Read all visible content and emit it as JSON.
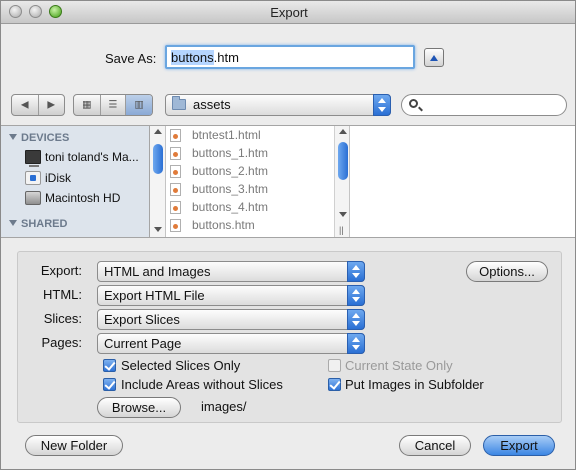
{
  "window": {
    "title": "Export"
  },
  "save_as": {
    "label": "Save As:",
    "value_selected": "buttons",
    "value_rest": ".htm"
  },
  "toolbar": {
    "nav_back": "◀",
    "nav_forward": "▶",
    "location": "assets",
    "search_placeholder": ""
  },
  "sidebar": {
    "devices_header": "DEVICES",
    "shared_header": "SHARED",
    "items": [
      {
        "label": "toni toland's Ma...",
        "icon": "computer-icon"
      },
      {
        "label": "iDisk",
        "icon": "idisk-icon"
      },
      {
        "label": "Macintosh HD",
        "icon": "hard-drive-icon"
      }
    ]
  },
  "files": [
    "btntest1.html",
    "buttons_1.htm",
    "buttons_2.htm",
    "buttons_3.htm",
    "buttons_4.htm",
    "buttons.htm"
  ],
  "options": {
    "export_label": "Export:",
    "export_value": "HTML and Images",
    "html_label": "HTML:",
    "html_value": "Export HTML File",
    "slices_label": "Slices:",
    "slices_value": "Export Slices",
    "pages_label": "Pages:",
    "pages_value": "Current Page",
    "options_button": "Options...",
    "selected_slices_only": "Selected Slices Only",
    "current_state_only": "Current State Only",
    "include_areas": "Include Areas without Slices",
    "put_images_subfolder": "Put Images in Subfolder",
    "browse_button": "Browse...",
    "folder_path": "images/"
  },
  "footer": {
    "new_folder": "New Folder",
    "cancel": "Cancel",
    "export": "Export"
  },
  "colors": {
    "accent": "#2a6fd4",
    "selection": "#b5d5ff"
  }
}
